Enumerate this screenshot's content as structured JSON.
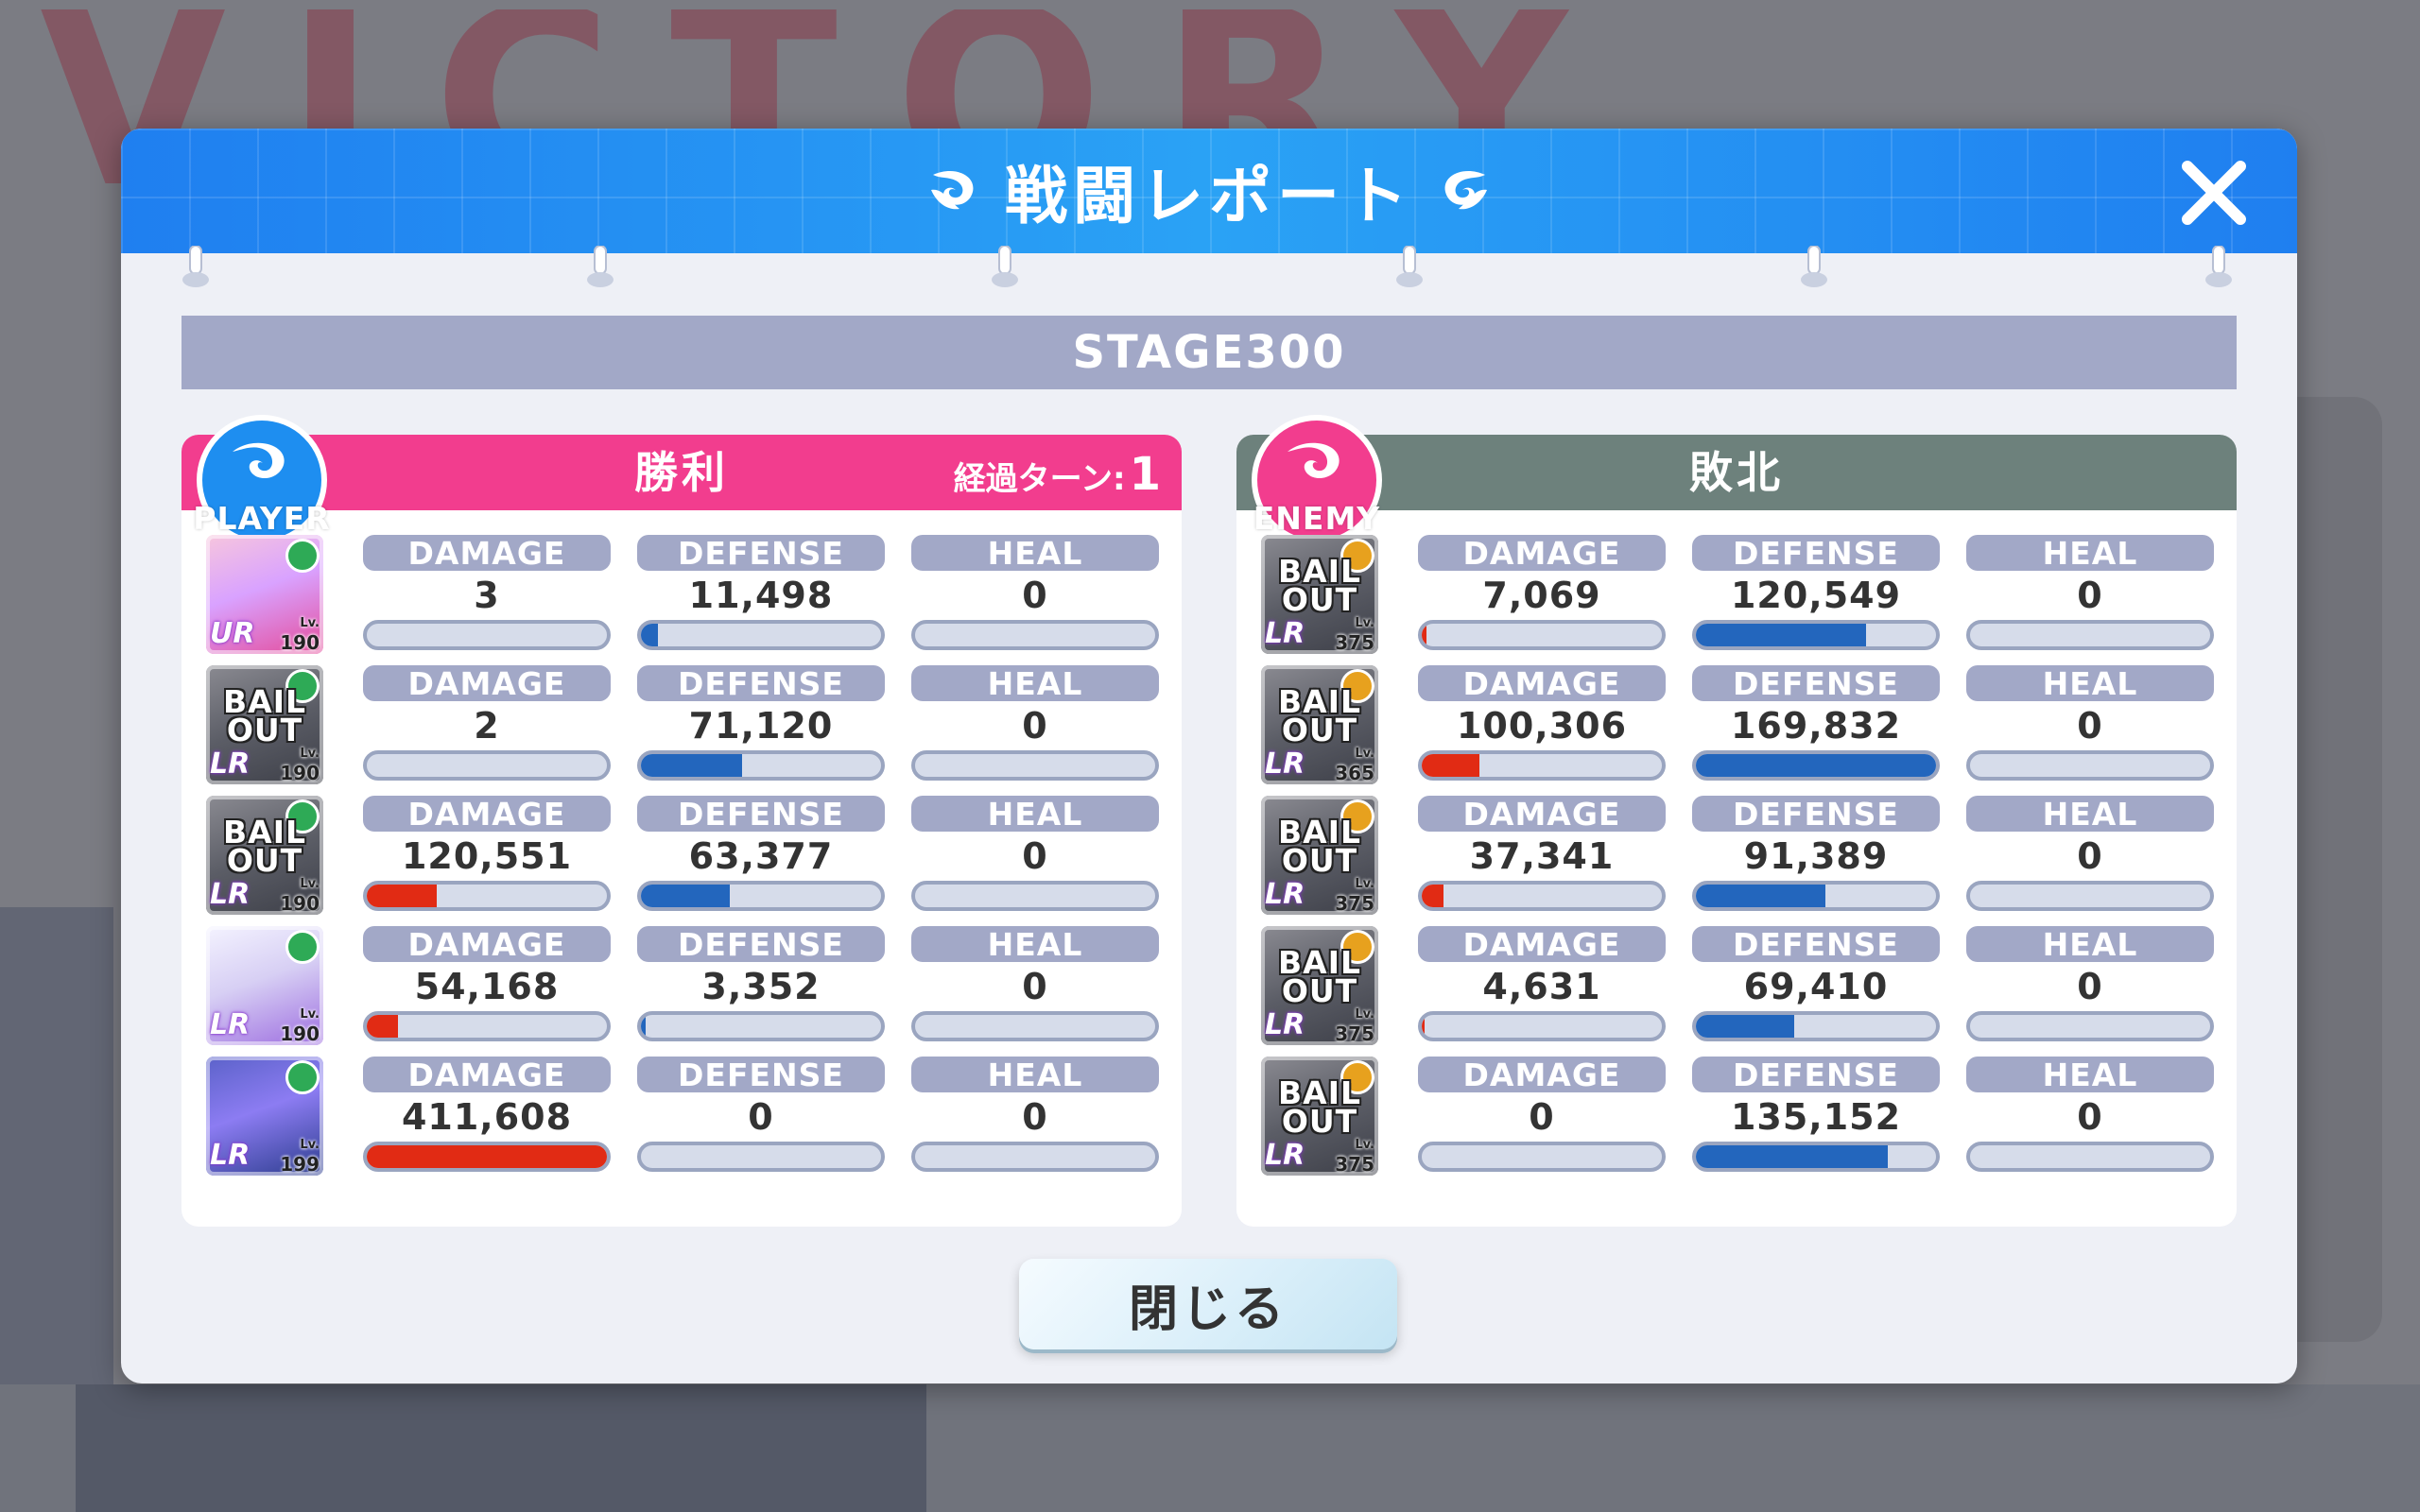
{
  "background": {
    "banner": "VICTORY"
  },
  "dialog": {
    "title": "戦闘レポート",
    "close_icon": "close-x-icon",
    "stage": "STAGE300",
    "close_button_label": "閉じる"
  },
  "colors": {
    "header_blue": "#1f7ff0",
    "player_pink": "#f23d8e",
    "enemy_gray": "#6d817c",
    "damage_red": "#e12b14",
    "defense_blue": "#2366bd",
    "column_header": "#a2a8c7"
  },
  "stat_labels": {
    "damage": "DAMAGE",
    "defense": "DEFENSE",
    "heal": "HEAL"
  },
  "player": {
    "badge": "PLAYER",
    "result": "勝利",
    "turns_label": "経過ターン:",
    "turns_value": "1",
    "units": [
      {
        "status": "",
        "rarity": "UR",
        "level_label": "Lv.",
        "level": "190",
        "damage": "3",
        "defense": "11,498",
        "heal": "0",
        "damage_ratio": 0.0,
        "defense_ratio": 0.07,
        "heal_ratio": 0.0
      },
      {
        "status": "BAIL OUT",
        "rarity": "LR",
        "level_label": "Lv.",
        "level": "190",
        "damage": "2",
        "defense": "71,120",
        "heal": "0",
        "damage_ratio": 0.0,
        "defense_ratio": 0.42,
        "heal_ratio": 0.0
      },
      {
        "status": "BAIL OUT",
        "rarity": "LR",
        "level_label": "Lv.",
        "level": "190",
        "damage": "120,551",
        "defense": "63,377",
        "heal": "0",
        "damage_ratio": 0.29,
        "defense_ratio": 0.37,
        "heal_ratio": 0.0
      },
      {
        "status": "",
        "rarity": "LR",
        "level_label": "Lv.",
        "level": "190",
        "damage": "54,168",
        "defense": "3,352",
        "heal": "0",
        "damage_ratio": 0.13,
        "defense_ratio": 0.02,
        "heal_ratio": 0.0
      },
      {
        "status": "",
        "rarity": "LR",
        "level_label": "Lv.",
        "level": "199",
        "damage": "411,608",
        "defense": "0",
        "heal": "0",
        "damage_ratio": 1.0,
        "defense_ratio": 0.0,
        "heal_ratio": 0.0
      }
    ]
  },
  "enemy": {
    "badge": "ENEMY",
    "result": "敗北",
    "units": [
      {
        "status": "BAIL OUT",
        "rarity": "LR",
        "level_label": "Lv.",
        "level": "375",
        "damage": "7,069",
        "defense": "120,549",
        "heal": "0",
        "damage_ratio": 0.02,
        "defense_ratio": 0.71,
        "heal_ratio": 0.0
      },
      {
        "status": "BAIL OUT",
        "rarity": "LR",
        "level_label": "Lv.",
        "level": "365",
        "damage": "100,306",
        "defense": "169,832",
        "heal": "0",
        "damage_ratio": 0.24,
        "defense_ratio": 1.0,
        "heal_ratio": 0.0
      },
      {
        "status": "BAIL OUT",
        "rarity": "LR",
        "level_label": "Lv.",
        "level": "375",
        "damage": "37,341",
        "defense": "91,389",
        "heal": "0",
        "damage_ratio": 0.09,
        "defense_ratio": 0.54,
        "heal_ratio": 0.0
      },
      {
        "status": "BAIL OUT",
        "rarity": "LR",
        "level_label": "Lv.",
        "level": "375",
        "damage": "4,631",
        "defense": "69,410",
        "heal": "0",
        "damage_ratio": 0.01,
        "defense_ratio": 0.41,
        "heal_ratio": 0.0
      },
      {
        "status": "BAIL OUT",
        "rarity": "LR",
        "level_label": "Lv.",
        "level": "375",
        "damage": "0",
        "defense": "135,152",
        "heal": "0",
        "damage_ratio": 0.0,
        "defense_ratio": 0.8,
        "heal_ratio": 0.0
      }
    ]
  }
}
